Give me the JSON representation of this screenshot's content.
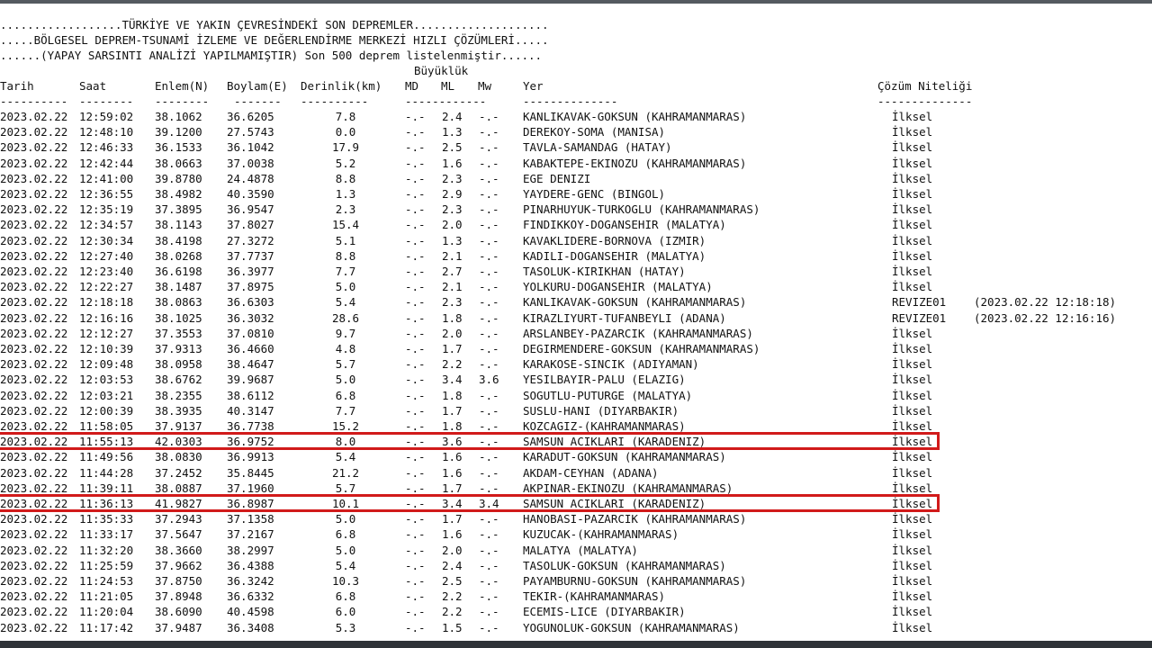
{
  "header": {
    "line1": "..................TÜRKİYE VE YAKIN ÇEVRESİNDEKİ SON DEPREMLER....................",
    "line2": ".....BÖLGESEL DEPREM-TSUNAMİ İZLEME VE DEĞERLENDİRME MERKEZİ HIZLI ÇÖZÜMLERİ.....",
    "line3": "......(YAPAY SARSINTI ANALİZİ YAPILMAMIŞTIR) Son 500 deprem listelenmiştir......",
    "magnitude_group": "Büyüklük"
  },
  "columns": {
    "date": "Tarih",
    "time": "Saat",
    "lat": "Enlem(N)",
    "lon": "Boylam(E)",
    "depth": "Derinlik(km)",
    "md": "MD",
    "ml": "ML",
    "mw": "Mw",
    "place": "Yer",
    "quality": "Çözüm Niteliği"
  },
  "underlines": {
    "date": "----------",
    "time": "--------",
    "lat": "--------",
    "lon": "-------",
    "depth": "----------",
    "mag": "------------",
    "place": "--------------",
    "quality": "--------------"
  },
  "rows": [
    {
      "date": "2023.02.22",
      "time": "12:59:02",
      "lat": "38.1062",
      "lon": "36.6205",
      "depth": "7.8",
      "md": "-.-",
      "ml": "2.4",
      "mw": "-.-",
      "place": "KANLIKAVAK-GOKSUN (KAHRAMANMARAS)",
      "quality": "İlksel",
      "extra": ""
    },
    {
      "date": "2023.02.22",
      "time": "12:48:10",
      "lat": "39.1200",
      "lon": "27.5743",
      "depth": "0.0",
      "md": "-.-",
      "ml": "1.3",
      "mw": "-.-",
      "place": "DEREKOY-SOMA (MANISA)",
      "quality": "İlksel",
      "extra": ""
    },
    {
      "date": "2023.02.22",
      "time": "12:46:33",
      "lat": "36.1533",
      "lon": "36.1042",
      "depth": "17.9",
      "md": "-.-",
      "ml": "2.5",
      "mw": "-.-",
      "place": "TAVLA-SAMANDAG (HATAY)",
      "quality": "İlksel",
      "extra": ""
    },
    {
      "date": "2023.02.22",
      "time": "12:42:44",
      "lat": "38.0663",
      "lon": "37.0038",
      "depth": "5.2",
      "md": "-.-",
      "ml": "1.6",
      "mw": "-.-",
      "place": "KABAKTEPE-EKINOZU (KAHRAMANMARAS)",
      "quality": "İlksel",
      "extra": ""
    },
    {
      "date": "2023.02.22",
      "time": "12:41:00",
      "lat": "39.8780",
      "lon": "24.4878",
      "depth": "8.8",
      "md": "-.-",
      "ml": "2.3",
      "mw": "-.-",
      "place": "EGE DENIZI",
      "quality": "İlksel",
      "extra": ""
    },
    {
      "date": "2023.02.22",
      "time": "12:36:55",
      "lat": "38.4982",
      "lon": "40.3590",
      "depth": "1.3",
      "md": "-.-",
      "ml": "2.9",
      "mw": "-.-",
      "place": "YAYDERE-GENC (BINGOL)",
      "quality": "İlksel",
      "extra": ""
    },
    {
      "date": "2023.02.22",
      "time": "12:35:19",
      "lat": "37.3895",
      "lon": "36.9547",
      "depth": "2.3",
      "md": "-.-",
      "ml": "2.3",
      "mw": "-.-",
      "place": "PINARHUYUK-TURKOGLU (KAHRAMANMARAS)",
      "quality": "İlksel",
      "extra": ""
    },
    {
      "date": "2023.02.22",
      "time": "12:34:57",
      "lat": "38.1143",
      "lon": "37.8027",
      "depth": "15.4",
      "md": "-.-",
      "ml": "2.0",
      "mw": "-.-",
      "place": "FINDIKKOY-DOGANSEHIR (MALATYA)",
      "quality": "İlksel",
      "extra": ""
    },
    {
      "date": "2023.02.22",
      "time": "12:30:34",
      "lat": "38.4198",
      "lon": "27.3272",
      "depth": "5.1",
      "md": "-.-",
      "ml": "1.3",
      "mw": "-.-",
      "place": "KAVAKLIDERE-BORNOVA (IZMIR)",
      "quality": "İlksel",
      "extra": ""
    },
    {
      "date": "2023.02.22",
      "time": "12:27:40",
      "lat": "38.0268",
      "lon": "37.7737",
      "depth": "8.8",
      "md": "-.-",
      "ml": "2.1",
      "mw": "-.-",
      "place": "KADILI-DOGANSEHIR (MALATYA)",
      "quality": "İlksel",
      "extra": ""
    },
    {
      "date": "2023.02.22",
      "time": "12:23:40",
      "lat": "36.6198",
      "lon": "36.3977",
      "depth": "7.7",
      "md": "-.-",
      "ml": "2.7",
      "mw": "-.-",
      "place": "TASOLUK-KIRIKHAN (HATAY)",
      "quality": "İlksel",
      "extra": ""
    },
    {
      "date": "2023.02.22",
      "time": "12:22:27",
      "lat": "38.1487",
      "lon": "37.8975",
      "depth": "5.0",
      "md": "-.-",
      "ml": "2.1",
      "mw": "-.-",
      "place": "YOLKURU-DOGANSEHIR (MALATYA)",
      "quality": "İlksel",
      "extra": ""
    },
    {
      "date": "2023.02.22",
      "time": "12:18:18",
      "lat": "38.0863",
      "lon": "36.6303",
      "depth": "5.4",
      "md": "-.-",
      "ml": "2.3",
      "mw": "-.-",
      "place": "KANLIKAVAK-GOKSUN (KAHRAMANMARAS)",
      "quality": "REVIZE01",
      "extra": "(2023.02.22 12:18:18)"
    },
    {
      "date": "2023.02.22",
      "time": "12:16:16",
      "lat": "38.1025",
      "lon": "36.3032",
      "depth": "28.6",
      "md": "-.-",
      "ml": "1.8",
      "mw": "-.-",
      "place": "KIRAZLIYURT-TUFANBEYLI (ADANA)",
      "quality": "REVIZE01",
      "extra": "(2023.02.22 12:16:16)"
    },
    {
      "date": "2023.02.22",
      "time": "12:12:27",
      "lat": "37.3553",
      "lon": "37.0810",
      "depth": "9.7",
      "md": "-.-",
      "ml": "2.0",
      "mw": "-.-",
      "place": "ARSLANBEY-PAZARCIK (KAHRAMANMARAS)",
      "quality": "İlksel",
      "extra": ""
    },
    {
      "date": "2023.02.22",
      "time": "12:10:39",
      "lat": "37.9313",
      "lon": "36.4660",
      "depth": "4.8",
      "md": "-.-",
      "ml": "1.7",
      "mw": "-.-",
      "place": "DEGIRMENDERE-GOKSUN (KAHRAMANMARAS)",
      "quality": "İlksel",
      "extra": ""
    },
    {
      "date": "2023.02.22",
      "time": "12:09:48",
      "lat": "38.0958",
      "lon": "38.4647",
      "depth": "5.7",
      "md": "-.-",
      "ml": "2.2",
      "mw": "-.-",
      "place": "KARAKOSE-SINCIK (ADIYAMAN)",
      "quality": "İlksel",
      "extra": ""
    },
    {
      "date": "2023.02.22",
      "time": "12:03:53",
      "lat": "38.6762",
      "lon": "39.9687",
      "depth": "5.0",
      "md": "-.-",
      "ml": "3.4",
      "mw": "3.6",
      "place": "YESILBAYIR-PALU (ELAZIG)",
      "quality": "İlksel",
      "extra": ""
    },
    {
      "date": "2023.02.22",
      "time": "12:03:21",
      "lat": "38.2355",
      "lon": "38.6112",
      "depth": "6.8",
      "md": "-.-",
      "ml": "1.8",
      "mw": "-.-",
      "place": "SOGUTLU-PUTURGE (MALATYA)",
      "quality": "İlksel",
      "extra": ""
    },
    {
      "date": "2023.02.22",
      "time": "12:00:39",
      "lat": "38.3935",
      "lon": "40.3147",
      "depth": "7.7",
      "md": "-.-",
      "ml": "1.7",
      "mw": "-.-",
      "place": "SUSLU-HANI (DIYARBAKIR)",
      "quality": "İlksel",
      "extra": ""
    },
    {
      "date": "2023.02.22",
      "time": "11:58:05",
      "lat": "37.9137",
      "lon": "36.7738",
      "depth": "15.2",
      "md": "-.-",
      "ml": "1.8",
      "mw": "-.-",
      "place": "KOZCAGIZ-(KAHRAMANMARAS)",
      "quality": "İlksel",
      "extra": ""
    },
    {
      "date": "2023.02.22",
      "time": "11:55:13",
      "lat": "42.0303",
      "lon": "36.9752",
      "depth": "8.0",
      "md": "-.-",
      "ml": "3.6",
      "mw": "-.-",
      "place": "SAMSUN ACIKLARI (KARADENIZ)",
      "quality": "İlksel",
      "extra": ""
    },
    {
      "date": "2023.02.22",
      "time": "11:49:56",
      "lat": "38.0830",
      "lon": "36.9913",
      "depth": "5.4",
      "md": "-.-",
      "ml": "1.6",
      "mw": "-.-",
      "place": "KARADUT-GOKSUN (KAHRAMANMARAS)",
      "quality": "İlksel",
      "extra": ""
    },
    {
      "date": "2023.02.22",
      "time": "11:44:28",
      "lat": "37.2452",
      "lon": "35.8445",
      "depth": "21.2",
      "md": "-.-",
      "ml": "1.6",
      "mw": "-.-",
      "place": "AKDAM-CEYHAN (ADANA)",
      "quality": "İlksel",
      "extra": ""
    },
    {
      "date": "2023.02.22",
      "time": "11:39:11",
      "lat": "38.0887",
      "lon": "37.1960",
      "depth": "5.7",
      "md": "-.-",
      "ml": "1.7",
      "mw": "-.-",
      "place": "AKPINAR-EKINOZU (KAHRAMANMARAS)",
      "quality": "İlksel",
      "extra": ""
    },
    {
      "date": "2023.02.22",
      "time": "11:36:13",
      "lat": "41.9827",
      "lon": "36.8987",
      "depth": "10.1",
      "md": "-.-",
      "ml": "3.4",
      "mw": "3.4",
      "place": "SAMSUN ACIKLARI (KARADENIZ)",
      "quality": "İlksel",
      "extra": ""
    },
    {
      "date": "2023.02.22",
      "time": "11:35:33",
      "lat": "37.2943",
      "lon": "37.1358",
      "depth": "5.0",
      "md": "-.-",
      "ml": "1.7",
      "mw": "-.-",
      "place": "HANOBASI-PAZARCIK (KAHRAMANMARAS)",
      "quality": "İlksel",
      "extra": ""
    },
    {
      "date": "2023.02.22",
      "time": "11:33:17",
      "lat": "37.5647",
      "lon": "37.2167",
      "depth": "6.8",
      "md": "-.-",
      "ml": "1.6",
      "mw": "-.-",
      "place": "KUZUCAK-(KAHRAMANMARAS)",
      "quality": "İlksel",
      "extra": ""
    },
    {
      "date": "2023.02.22",
      "time": "11:32:20",
      "lat": "38.3660",
      "lon": "38.2997",
      "depth": "5.0",
      "md": "-.-",
      "ml": "2.0",
      "mw": "-.-",
      "place": "MALATYA (MALATYA)",
      "quality": "İlksel",
      "extra": ""
    },
    {
      "date": "2023.02.22",
      "time": "11:25:59",
      "lat": "37.9662",
      "lon": "36.4388",
      "depth": "5.4",
      "md": "-.-",
      "ml": "2.4",
      "mw": "-.-",
      "place": "TASOLUK-GOKSUN (KAHRAMANMARAS)",
      "quality": "İlksel",
      "extra": ""
    },
    {
      "date": "2023.02.22",
      "time": "11:24:53",
      "lat": "37.8750",
      "lon": "36.3242",
      "depth": "10.3",
      "md": "-.-",
      "ml": "2.5",
      "mw": "-.-",
      "place": "PAYAMBURNU-GOKSUN (KAHRAMANMARAS)",
      "quality": "İlksel",
      "extra": ""
    },
    {
      "date": "2023.02.22",
      "time": "11:21:05",
      "lat": "37.8948",
      "lon": "36.6332",
      "depth": "6.8",
      "md": "-.-",
      "ml": "2.2",
      "mw": "-.-",
      "place": "TEKIR-(KAHRAMANMARAS)",
      "quality": "İlksel",
      "extra": ""
    },
    {
      "date": "2023.02.22",
      "time": "11:20:04",
      "lat": "38.6090",
      "lon": "40.4598",
      "depth": "6.0",
      "md": "-.-",
      "ml": "2.2",
      "mw": "-.-",
      "place": "ECEMIS-LICE (DIYARBAKIR)",
      "quality": "İlksel",
      "extra": ""
    },
    {
      "date": "2023.02.22",
      "time": "11:17:42",
      "lat": "37.9487",
      "lon": "36.3408",
      "depth": "5.3",
      "md": "-.-",
      "ml": "1.5",
      "mw": "-.-",
      "place": "YOGUNOLUK-GOKSUN (KAHRAMANMARAS)",
      "quality": "İlksel",
      "extra": ""
    }
  ],
  "highlighted_rows": [
    21,
    25
  ],
  "colors": {
    "highlight": "#d11a1a",
    "text": "#111111",
    "background": "#ffffff"
  }
}
